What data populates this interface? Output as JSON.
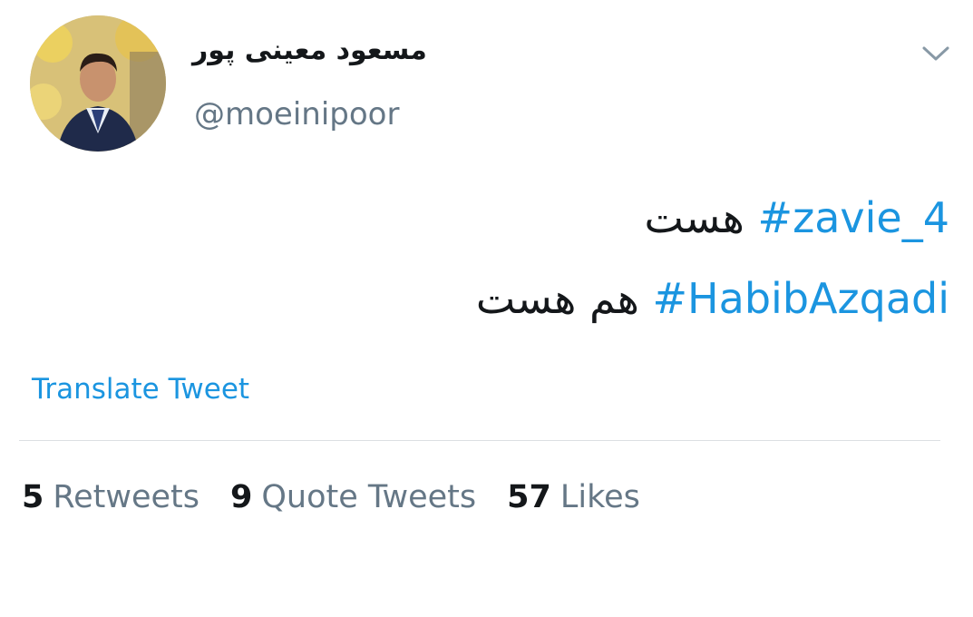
{
  "tweet": {
    "author": {
      "display_name": "مسعود معینی پور",
      "handle": "@moeinipoor",
      "avatar": "profile-photo"
    },
    "menu_icon": "chevron-down-icon",
    "lines": [
      {
        "hashtag": "#zavie_4",
        "text": "هست"
      },
      {
        "hashtag": "#HabibAzqadi",
        "text": "هم هست"
      }
    ],
    "translate_label": "Translate Tweet",
    "stats": [
      {
        "count": "5",
        "label": "Retweets"
      },
      {
        "count": "9",
        "label": "Quote Tweets"
      },
      {
        "count": "57",
        "label": "Likes"
      }
    ]
  },
  "colors": {
    "link": "#1b95e0",
    "secondary_text": "#657786",
    "primary_text": "#14171a",
    "divider": "#dcdfe2"
  }
}
